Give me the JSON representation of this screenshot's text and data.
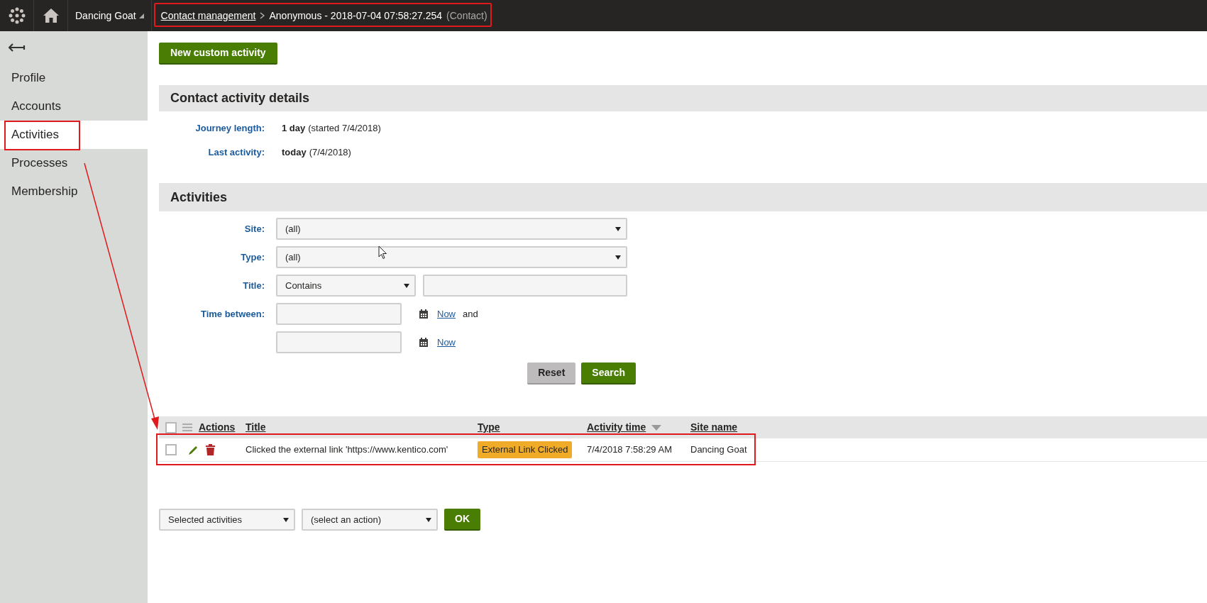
{
  "top_bar": {
    "site_name": "Dancing Goat",
    "breadcrumb": {
      "link": "Contact management",
      "current": "Anonymous - 2018-07-04 07:58:27.254",
      "suffix": "(Contact)"
    }
  },
  "sidebar": {
    "items": [
      {
        "label": "Profile",
        "selected": false
      },
      {
        "label": "Accounts",
        "selected": false
      },
      {
        "label": "Activities",
        "selected": true
      },
      {
        "label": "Processes",
        "selected": false
      },
      {
        "label": "Membership",
        "selected": false
      }
    ]
  },
  "new_button": "New custom activity",
  "details": {
    "title": "Contact activity details",
    "fields": [
      {
        "label": "Journey length:",
        "value": "1 day",
        "note": "(started 7/4/2018)"
      },
      {
        "label": "Last activity:",
        "value": "today",
        "note": "(7/4/2018)"
      }
    ]
  },
  "activities": {
    "title": "Activities",
    "filters": [
      {
        "kind": "select",
        "label": "Site:",
        "value": "(all)"
      },
      {
        "kind": "select",
        "label": "Type:",
        "value": "(all)"
      },
      {
        "kind": "operator",
        "label": "Title:",
        "value": "Contains"
      },
      {
        "kind": "time",
        "label": "Time between:",
        "link": "Now",
        "joiner": "and"
      },
      {
        "kind": "time",
        "link": "Now"
      }
    ],
    "buttons": [
      {
        "label": "Reset",
        "kind": "secondary"
      },
      {
        "label": "Search",
        "kind": "primary"
      }
    ]
  },
  "table": {
    "header_checked": false,
    "columns": [
      {
        "label": "Actions",
        "sorted": false
      },
      {
        "label": "Title",
        "sorted": false
      },
      {
        "label": "Type",
        "sorted": false
      },
      {
        "label": "Activity time",
        "sorted": true
      },
      {
        "label": "Site name",
        "sorted": false
      }
    ],
    "rows": [
      {
        "checked": false,
        "title": "Clicked the external link 'https://www.kentico.com'",
        "type": "External Link Clicked",
        "time": "7/4/2018 7:58:29 AM",
        "site": "Dancing Goat"
      }
    ]
  },
  "mass_action": {
    "scope": "Selected activities",
    "action": "(select an action)",
    "button": "OK"
  }
}
